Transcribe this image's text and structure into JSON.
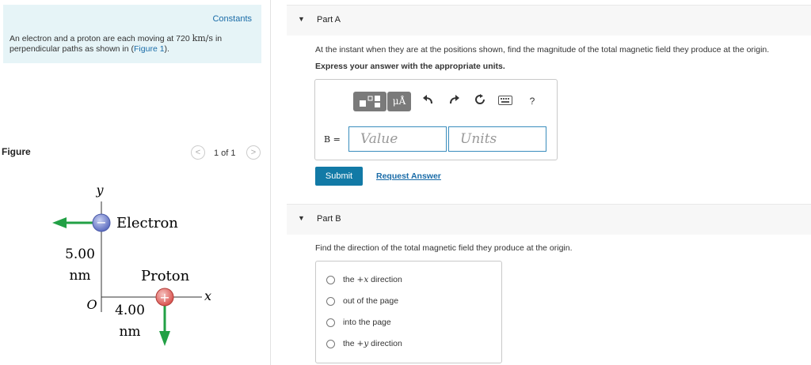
{
  "problem": {
    "constants_label": "Constants",
    "intro_prefix": "An electron and a proton are each moving at 720",
    "intro_unit": "km/s",
    "intro_mid": "in perpendicular paths as shown in (",
    "figure_link": "Figure 1",
    "intro_end": ")."
  },
  "figure": {
    "label": "Figure",
    "counter": "1 of 1",
    "prev_icon": "chevron-left-icon",
    "next_icon": "chevron-right-icon",
    "prev_glyph": "<",
    "next_glyph": ">",
    "axis_y": "y",
    "axis_x": "x",
    "origin": "O",
    "electron_label": "Electron",
    "proton_label": "Proton",
    "dist_vertical_value": "5.00",
    "dist_vertical_unit": "nm",
    "dist_horizontal_value": "4.00",
    "dist_horizontal_unit": "nm",
    "electron_sign": "−",
    "proton_sign": "+",
    "arrow_color": "#22a045",
    "electron_color": "#6f7fc9",
    "proton_color": "#e0706c"
  },
  "partA": {
    "title": "Part A",
    "expand_icon": "triangle-down-icon",
    "question": "At the instant when they are at the positions shown, find the magnitude of the total magnetic field they produce at the origin.",
    "instruction": "Express your answer with the appropriate units.",
    "toolbar": {
      "templates_icon": "templates-icon",
      "units_icon": "units-icon",
      "units_glyph": "μÅ",
      "undo_icon": "undo-icon",
      "redo_icon": "redo-icon",
      "reset_icon": "reset-icon",
      "keyboard_icon": "keyboard-icon",
      "help_label": "?"
    },
    "var_label": "B =",
    "value_placeholder": "Value",
    "units_placeholder": "Units",
    "submit_label": "Submit",
    "request_label": "Request Answer"
  },
  "partB": {
    "title": "Part B",
    "expand_icon": "triangle-down-icon",
    "question": "Find the direction of the total magnetic field they produce at the origin.",
    "options": [
      {
        "pre": "the ",
        "math": "+x",
        "post": " direction"
      },
      {
        "pre": "out of the page",
        "math": "",
        "post": ""
      },
      {
        "pre": "into the page",
        "math": "",
        "post": ""
      },
      {
        "pre": "the ",
        "math": "+y",
        "post": " direction"
      }
    ]
  }
}
